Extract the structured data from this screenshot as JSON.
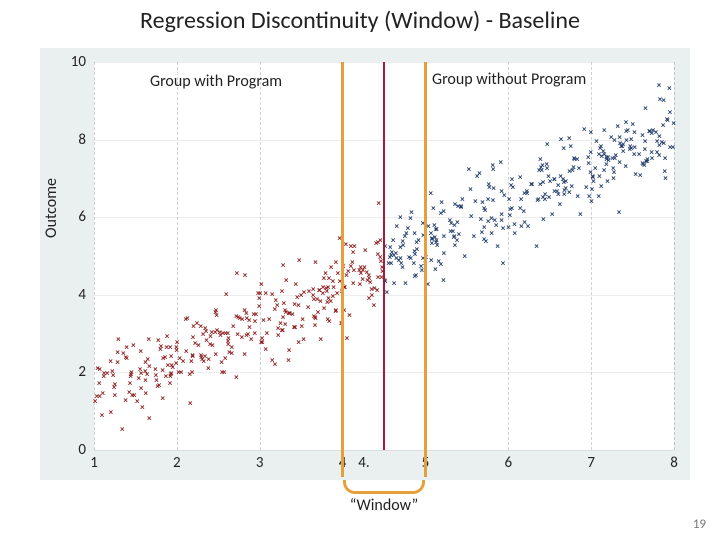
{
  "title": "Regression Discontinuity (Window) - Baseline",
  "labels": {
    "group_left": "Group with Program",
    "group_right": "Group without Program",
    "window": "“Window”",
    "y_axis": "Outcome"
  },
  "page_number": "19",
  "chart_data": {
    "type": "scatter",
    "xlabel": "",
    "ylabel": "Outcome",
    "xlim": [
      1,
      8
    ],
    "ylim": [
      0,
      10
    ],
    "x_ticks": [
      1,
      2,
      3,
      4,
      5,
      6,
      7,
      8
    ],
    "y_ticks": [
      0,
      2,
      4,
      6,
      8,
      10
    ],
    "cutoff_x": 4.5,
    "window": {
      "low": 4.0,
      "high": 5.0
    },
    "series": [
      {
        "name": "Group with Program",
        "color": "#8b1a1a",
        "generator": {
          "x_range": [
            1.0,
            4.5
          ],
          "n": 300,
          "y_mean_line": {
            "slope": 1.0,
            "intercept": 0.3
          },
          "noise_sd": 0.55
        }
      },
      {
        "name": "Group without Program",
        "color": "#1f3b6b",
        "generator": {
          "x_range": [
            4.5,
            8.0
          ],
          "n": 300,
          "y_mean_line": {
            "slope": 1.0,
            "intercept": 0.3
          },
          "noise_sd": 0.55
        }
      }
    ],
    "annotations": [
      {
        "text": "Group with Program",
        "x": 2.0,
        "y": 9.4
      },
      {
        "text": "Group without Program",
        "x": 5.7,
        "y": 9.4
      }
    ],
    "window_center_tick": "4."
  }
}
